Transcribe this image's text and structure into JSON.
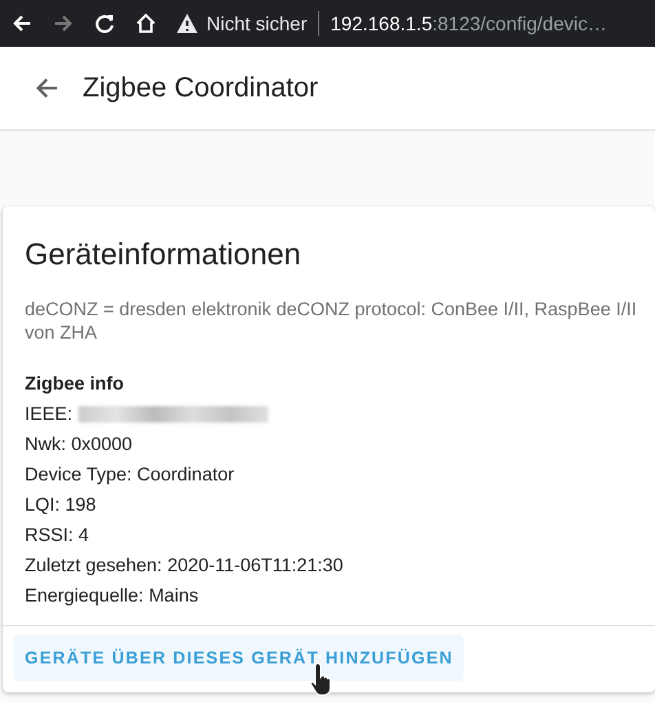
{
  "browser": {
    "warning": "Nicht sicher",
    "host": "192.168.1.5",
    "path": ":8123/config/devic…"
  },
  "header": {
    "title": "Zigbee Coordinator"
  },
  "card": {
    "title": "Geräteinformationen",
    "description": "deCONZ = dresden elektronik deCONZ protocol: ConBee I/II, RaspBee I/II von ZHA",
    "section_title": "Zigbee info",
    "lines": [
      {
        "text": "IEEE:",
        "redacted": true
      },
      {
        "text": "Nwk: 0x0000",
        "redacted": false
      },
      {
        "text": "Device Type: Coordinator",
        "redacted": false
      },
      {
        "text": "LQI: 198",
        "redacted": false
      },
      {
        "text": "RSSI: 4",
        "redacted": false
      },
      {
        "text": "Zuletzt gesehen: 2020-11-06T11:21:30",
        "redacted": false
      },
      {
        "text": "Energiequelle: Mains",
        "redacted": false
      }
    ],
    "action": "GERÄTE ÜBER DIESES GERÄT HINZUFÜGEN"
  }
}
